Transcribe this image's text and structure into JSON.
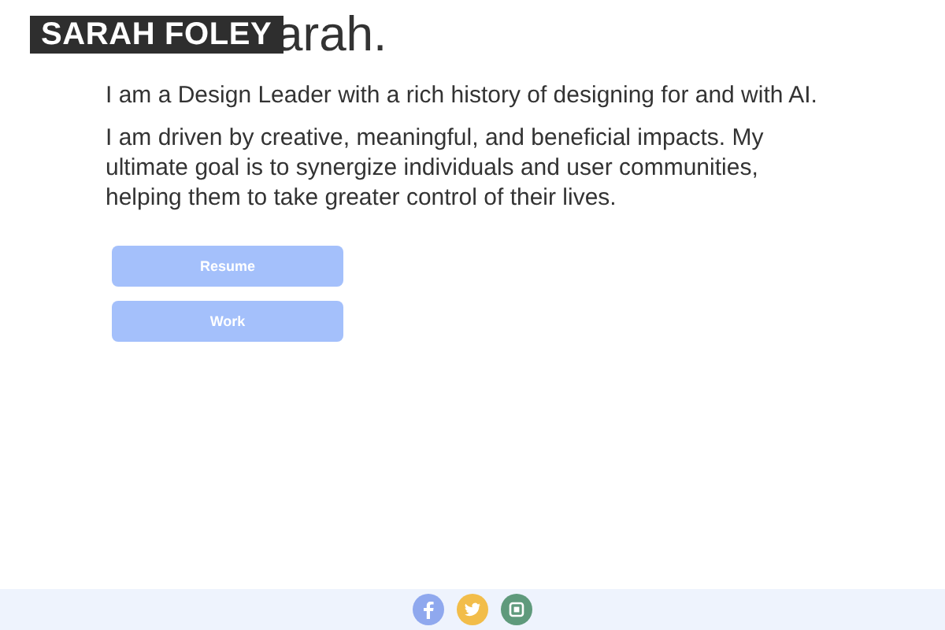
{
  "logo": "SARAH FOLEY",
  "heading": "arah.",
  "paragraphs": [
    "I am a Design Leader with a rich history of designing for and with AI.",
    "I am driven by creative, meaningful, and beneficial impacts. My ultimate goal is to synergize individuals and user communities, helping them to take greater control of their lives."
  ],
  "buttons": [
    "Resume",
    "Work"
  ],
  "social": [
    {
      "kind": "facebook",
      "color": "#8fa8ee"
    },
    {
      "kind": "twitter",
      "color": "#f2bd4a"
    },
    {
      "kind": "instagram",
      "color": "#5f9a7c"
    }
  ]
}
